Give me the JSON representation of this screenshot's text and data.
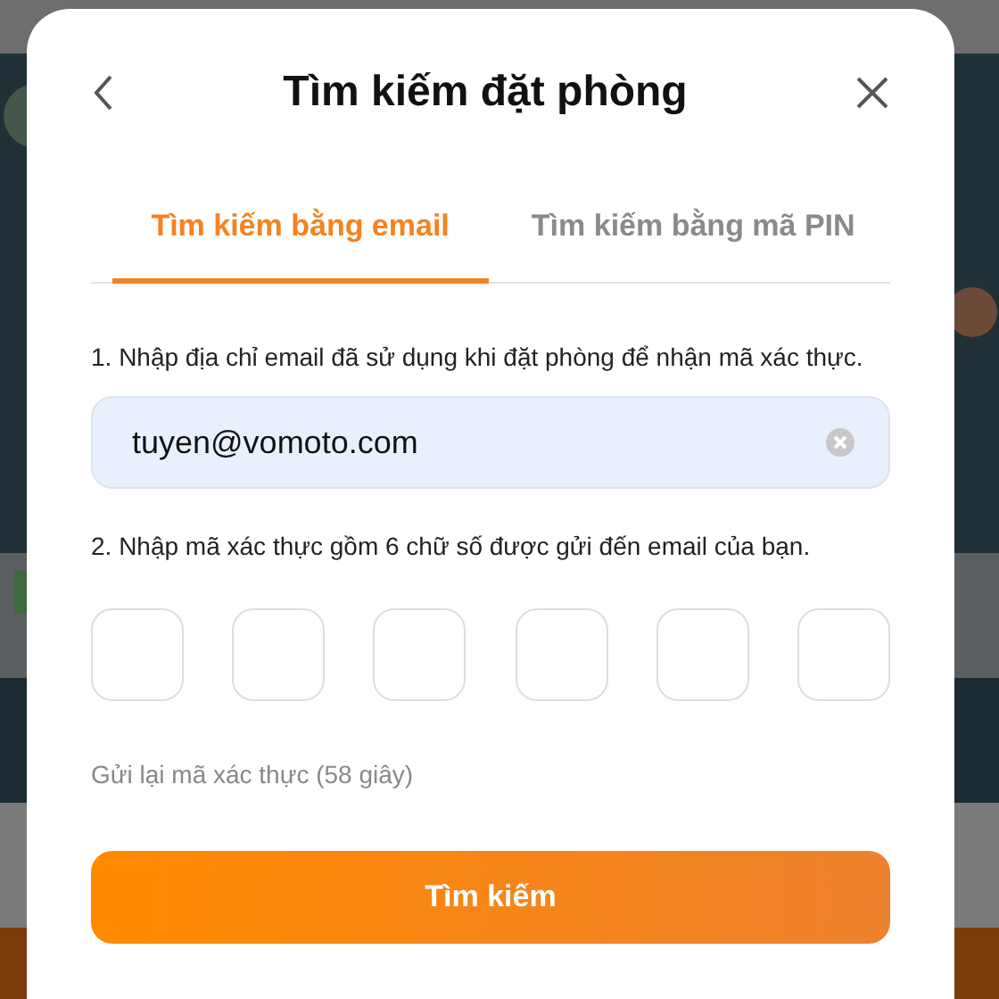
{
  "dialog": {
    "title": "Tìm kiếm đặt phòng",
    "tabs": [
      {
        "label": "Tìm kiếm bằng email",
        "selected": true
      },
      {
        "label": "Tìm kiếm bằng mã PIN",
        "selected": false
      }
    ],
    "email_step": {
      "label": "1. Nhập địa chỉ email đã sử dụng khi đặt phòng để nhận mã xác thực.",
      "value": "tuyen@vomoto.com"
    },
    "code_step": {
      "label": "2. Nhập mã xác thực gồm 6 chữ số được gửi đến email của bạn.",
      "boxes": [
        {
          "kind": "digit"
        },
        {
          "kind": "digit"
        },
        {
          "kind": "digit"
        },
        {
          "kind": "digit"
        },
        {
          "kind": "digit"
        },
        {
          "kind": "digit"
        }
      ]
    },
    "resend": "Gửi lại mã xác thực (58 giây)",
    "submit": "Tìm kiếm"
  }
}
